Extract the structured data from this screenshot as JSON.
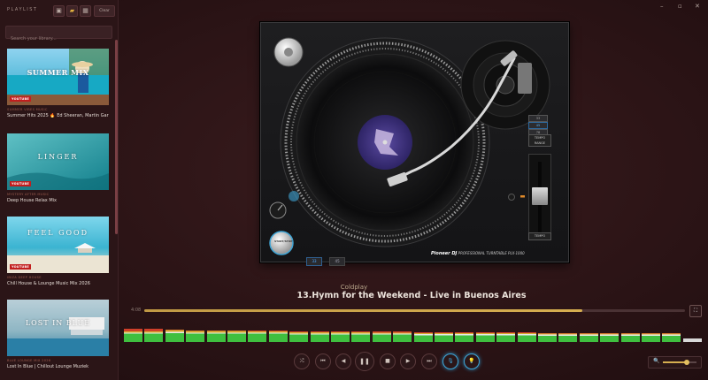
{
  "sidebar": {
    "title": "PLAYLIST",
    "clear_label": "Clear",
    "search_placeholder": "Search your library...",
    "items": [
      {
        "thumb_caption": "SUMMER MIX",
        "badge": "YOUTUBE",
        "subtitle": "SUMMER VIBES MUSIC",
        "name": "Summer Hits 2025 🔥 Ed Sheeran, Martin Garrix, ..."
      },
      {
        "thumb_caption": "LINGER",
        "badge": "YOUTUBE",
        "subtitle": "MYSTERY AFTER MUSIC",
        "name": "Deep House Relax Mix"
      },
      {
        "thumb_caption": "FEEL GOOD",
        "badge": "YOUTUBE",
        "subtitle": "IBIZA DEEP HOUSE",
        "name": "Chill House & Lounge Music Mix 2026"
      },
      {
        "thumb_caption": "LOST IN BLUE",
        "badge": "",
        "subtitle": "BLUE LOUNGE MIX 2026",
        "name": "Lost In Blue | Chillout Lounge Muziek"
      }
    ]
  },
  "deck": {
    "speed_buttons": [
      "33",
      "45",
      "78"
    ],
    "tempo_label_1": "TEMPO",
    "tempo_label_2": "RANGE",
    "tempo_bottom": "TEMPO",
    "start_stop": "START/STOP",
    "footer_tabs": [
      "33",
      "45"
    ],
    "brand": "Pioneer DJ",
    "brand_sub": "PROFESSIONAL TURNTABLE PLX-1000",
    "pitch_ticks": [
      "+8",
      "+6",
      "+4",
      "+2",
      "0",
      "-2",
      "-4",
      "-6",
      "-8"
    ]
  },
  "now_playing": {
    "artist": "Coldplay",
    "title": "13.Hymn for the Weekend - Live in Buenos Aires",
    "time_label": "4:08",
    "progress": 0.81
  },
  "spectrum": [
    {
      "green": 0.55,
      "red": 0.12,
      "yellow": 0.08
    },
    {
      "green": 0.55,
      "red": 0.12,
      "yellow": 0.08
    },
    {
      "green": 0.6,
      "red": 0.0,
      "yellow": 0.12
    },
    {
      "green": 0.55,
      "red": 0.0,
      "yellow": 0.12
    },
    {
      "green": 0.55,
      "red": 0.0,
      "yellow": 0.1
    },
    {
      "green": 0.55,
      "red": 0.0,
      "yellow": 0.1
    },
    {
      "green": 0.55,
      "red": 0.0,
      "yellow": 0.08
    },
    {
      "green": 0.55,
      "red": 0.0,
      "yellow": 0.08
    },
    {
      "green": 0.5,
      "red": 0.0,
      "yellow": 0.08
    },
    {
      "green": 0.5,
      "red": 0.0,
      "yellow": 0.08
    },
    {
      "green": 0.5,
      "red": 0.0,
      "yellow": 0.08
    },
    {
      "green": 0.5,
      "red": 0.0,
      "yellow": 0.08
    },
    {
      "green": 0.5,
      "red": 0.0,
      "yellow": 0.06
    },
    {
      "green": 0.5,
      "red": 0.0,
      "yellow": 0.06
    },
    {
      "green": 0.45,
      "red": 0.0,
      "yellow": 0.06
    },
    {
      "green": 0.45,
      "red": 0.0,
      "yellow": 0.06
    },
    {
      "green": 0.45,
      "red": 0.0,
      "yellow": 0.06
    },
    {
      "green": 0.45,
      "red": 0.0,
      "yellow": 0.06
    },
    {
      "green": 0.45,
      "red": 0.0,
      "yellow": 0.06
    },
    {
      "green": 0.45,
      "red": 0.0,
      "yellow": 0.06
    },
    {
      "green": 0.42,
      "red": 0.0,
      "yellow": 0.06
    },
    {
      "green": 0.42,
      "red": 0.0,
      "yellow": 0.06
    },
    {
      "green": 0.42,
      "red": 0.0,
      "yellow": 0.06
    },
    {
      "green": 0.42,
      "red": 0.0,
      "yellow": 0.06
    },
    {
      "green": 0.42,
      "red": 0.0,
      "yellow": 0.06
    },
    {
      "green": 0.42,
      "red": 0.0,
      "yellow": 0.06
    },
    {
      "green": 0.42,
      "red": 0.0,
      "yellow": 0.06
    },
    {
      "green": 0.1,
      "red": 0.0,
      "yellow": 0.0
    }
  ],
  "controls": {
    "shuffle": "⤮",
    "first": "⏮",
    "prev": "◀",
    "pause": "❚❚",
    "stop": "■",
    "next": "▶",
    "last": "⏭",
    "mic": "🎙",
    "light": "💡"
  },
  "volume": {
    "level": 0.72
  },
  "colors": {
    "accent": "#d6ae50",
    "blue": "#3fa4d4",
    "bg": "#2a1416"
  }
}
